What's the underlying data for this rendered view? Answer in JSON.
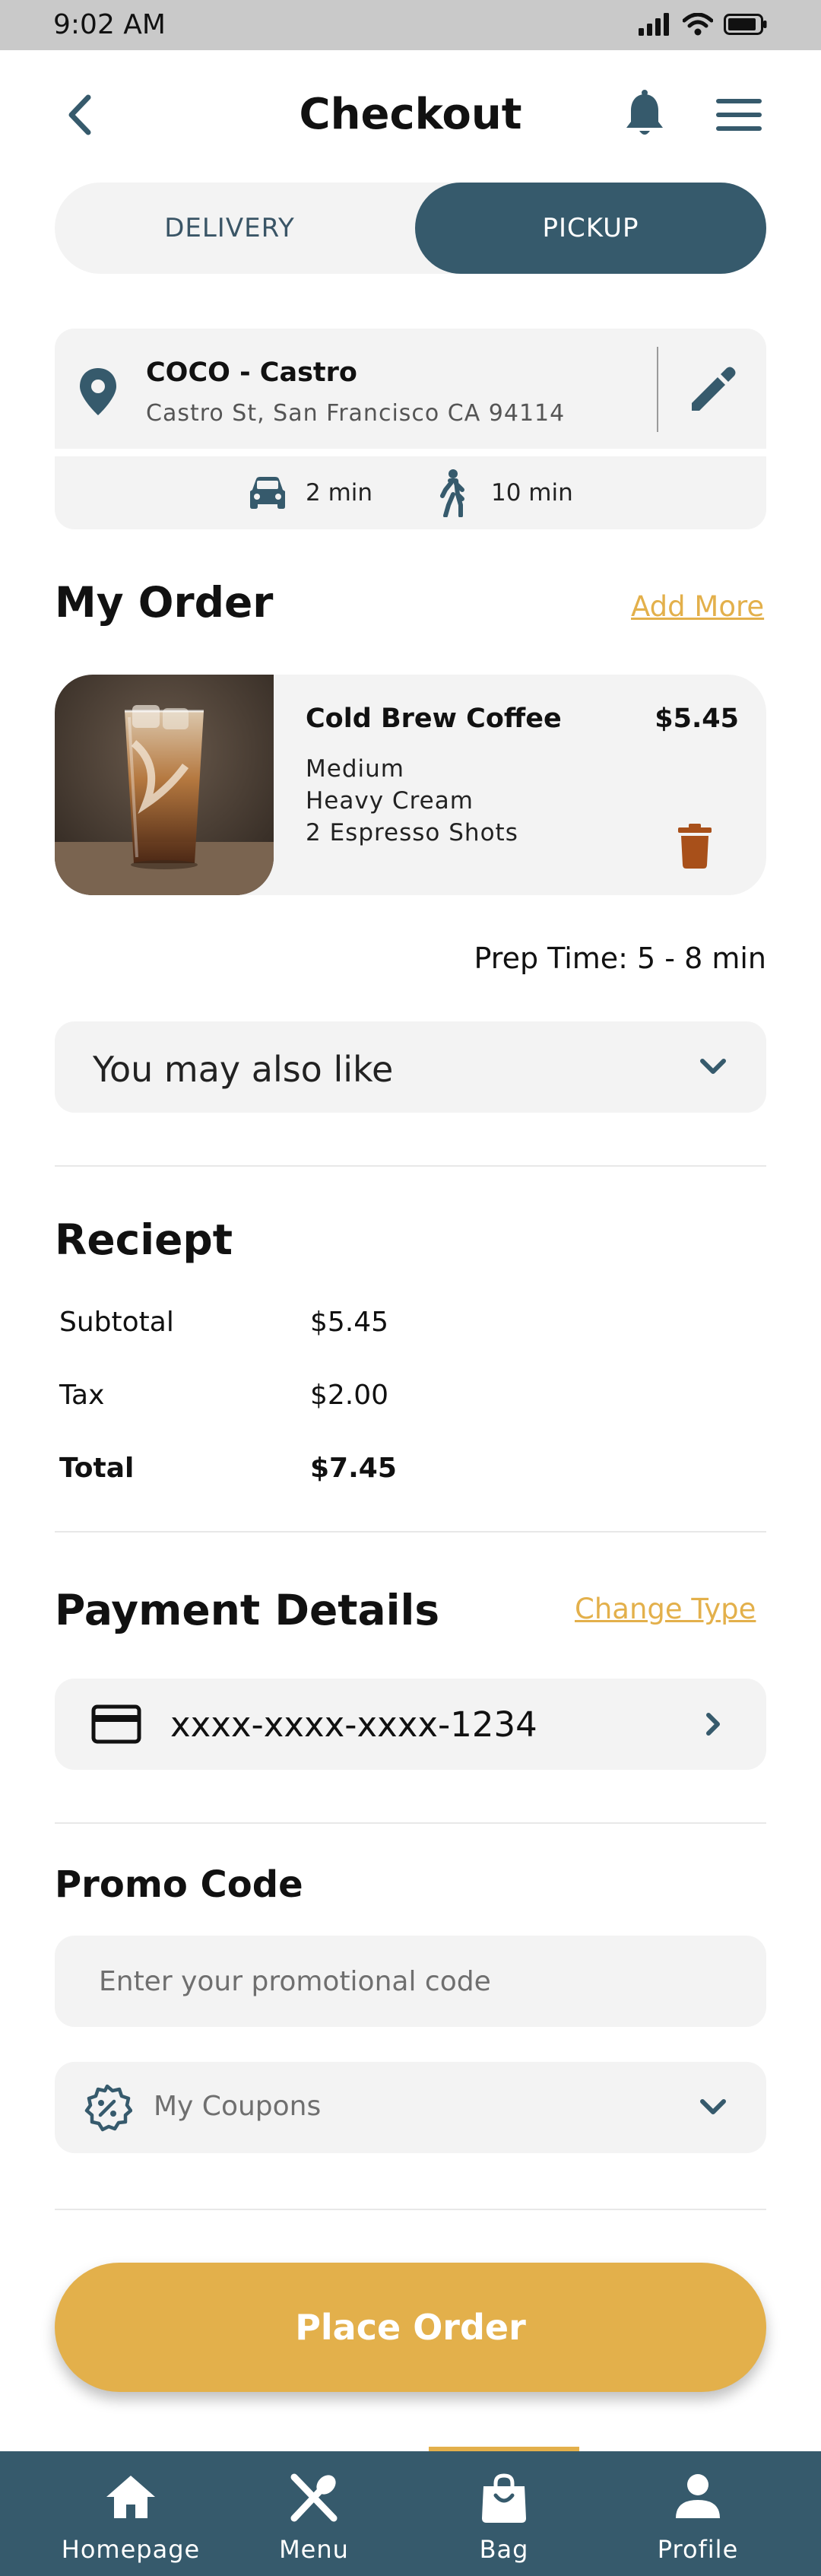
{
  "status_bar": {
    "time": "9:02 AM",
    "icons": [
      "signal-icon",
      "wifi-icon",
      "battery-icon"
    ]
  },
  "header": {
    "title": "Checkout",
    "icons": [
      "back-icon",
      "bell-icon",
      "menu-icon"
    ]
  },
  "mode_toggle": {
    "options": [
      "DELIVERY",
      "PICKUP"
    ],
    "selected": "PICKUP"
  },
  "store": {
    "name": "COCO - Castro",
    "address": "Castro St, San Francisco CA 94114",
    "car_time": "2 min",
    "walk_time": "10 min"
  },
  "my_order": {
    "title": "My Order",
    "add_more": "Add More",
    "item": {
      "name": "Cold Brew Coffee",
      "price": "$5.45",
      "options": [
        "Medium",
        "Heavy Cream",
        "2 Espresso Shots"
      ]
    },
    "prep_time": "Prep Time: 5 - 8 min",
    "suggestions_label": "You may also like"
  },
  "receipt": {
    "title": "Reciept",
    "rows": [
      {
        "label": "Subtotal",
        "value": "$5.45"
      },
      {
        "label": "Tax",
        "value": "$2.00"
      },
      {
        "label": "Total",
        "value": "$7.45"
      }
    ]
  },
  "payment": {
    "title": "Payment Details",
    "change_link": "Change Type",
    "card_number": "xxxx-xxxx-xxxx-1234"
  },
  "promo": {
    "title": "Promo Code",
    "placeholder": "Enter your promotional code",
    "coupons_label": "My Coupons"
  },
  "place_order": "Place Order",
  "bottom_nav": {
    "items": [
      {
        "label": "Homepage",
        "icon": "home-icon"
      },
      {
        "label": "Menu",
        "icon": "utensils-icon"
      },
      {
        "label": "Bag",
        "icon": "bag-icon"
      },
      {
        "label": "Profile",
        "icon": "profile-icon"
      }
    ],
    "active": "Bag"
  },
  "colors": {
    "primary": "#365a6c",
    "accent": "#e3b04b",
    "surface": "#f3f3f3",
    "trash": "#a8501a"
  }
}
